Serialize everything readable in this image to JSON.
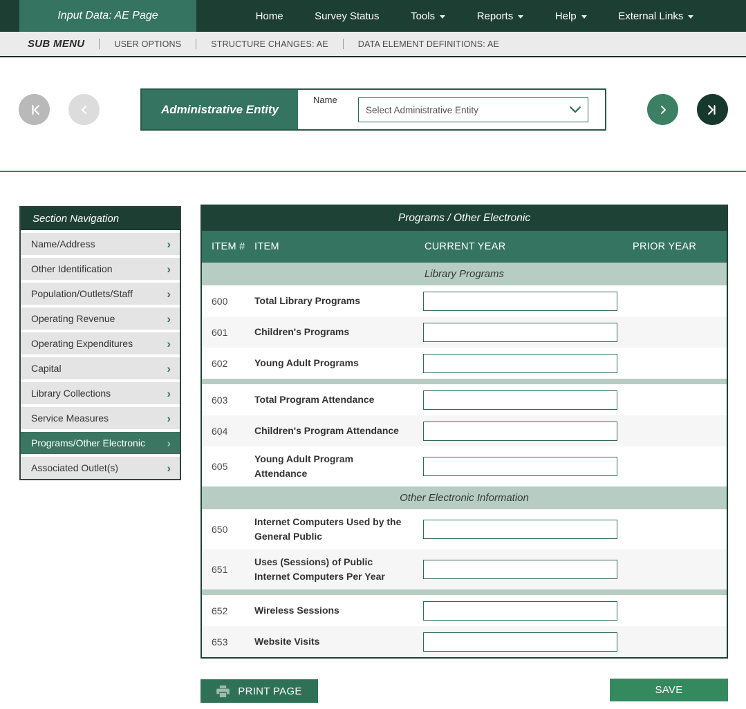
{
  "colors": {
    "green-dark": "#1d3e33",
    "green-accent": "#347460",
    "green-mid": "#3c8064",
    "green-deepest": "#17392d",
    "sage": "#b7ccc3"
  },
  "topnav": {
    "active_tab": "Input Data: AE Page",
    "items": [
      {
        "label": "Home",
        "dropdown": false
      },
      {
        "label": "Survey Status",
        "dropdown": false
      },
      {
        "label": "Tools",
        "dropdown": true
      },
      {
        "label": "Reports",
        "dropdown": true
      },
      {
        "label": "Help",
        "dropdown": true
      },
      {
        "label": "External Links",
        "dropdown": true
      }
    ]
  },
  "submenu": {
    "title": "SUB MENU",
    "items": [
      "USER OPTIONS",
      "STRUCTURE CHANGES: AE",
      "DATA ELEMENT DEFINITIONS: AE"
    ]
  },
  "entity_header": {
    "title": "Administrative Entity",
    "name_label": "Name",
    "select_value": "Select Administrative Entity"
  },
  "pager_icons": {
    "first": "first-page-icon",
    "previous": "chevron-left-icon",
    "next": "chevron-right-icon",
    "last": "last-page-icon"
  },
  "sidebar": {
    "title": "Section Navigation",
    "active_item": "Programs/Other Electronic",
    "items": [
      "Name/Address",
      "Other Identification",
      "Population/Outlets/Staff",
      "Operating Revenue",
      "Operating Expenditures",
      "Capital",
      "Library Collections",
      "Service Measures",
      "Programs/Other Electronic",
      "Associated Outlet(s)"
    ]
  },
  "table": {
    "title": "Programs / Other Electronic",
    "columns": [
      "ITEM #",
      "ITEM",
      "CURRENT YEAR",
      "PRIOR YEAR"
    ],
    "groups": [
      {
        "header": "Library Programs",
        "rows": [
          {
            "num": "600",
            "label": "Total Library Programs",
            "current": "",
            "prior": ""
          },
          {
            "num": "601",
            "label": "Children's Programs",
            "current": "",
            "prior": ""
          },
          {
            "num": "602",
            "label": "Young Adult Programs",
            "current": "",
            "prior": ""
          }
        ]
      },
      {
        "header": null,
        "rows": [
          {
            "num": "603",
            "label": "Total Program Attendance",
            "current": "",
            "prior": ""
          },
          {
            "num": "604",
            "label": "Children's Program Attendance",
            "current": "",
            "prior": ""
          },
          {
            "num": "605",
            "label": "Young Adult Program Attendance",
            "current": "",
            "prior": ""
          }
        ]
      },
      {
        "header": "Other Electronic Information",
        "rows": [
          {
            "num": "650",
            "label": "Internet Computers Used by the General Public",
            "current": "",
            "prior": ""
          },
          {
            "num": "651",
            "label": "Uses (Sessions) of Public Internet Computers Per Year",
            "current": "",
            "prior": ""
          }
        ]
      },
      {
        "header": null,
        "rows": [
          {
            "num": "652",
            "label": "Wireless Sessions",
            "current": "",
            "prior": ""
          },
          {
            "num": "653",
            "label": "Website Visits",
            "current": "",
            "prior": ""
          }
        ]
      }
    ]
  },
  "footer": {
    "print_label": "PRINT PAGE",
    "print_icon": "printer-icon",
    "save_label": "SAVE"
  }
}
